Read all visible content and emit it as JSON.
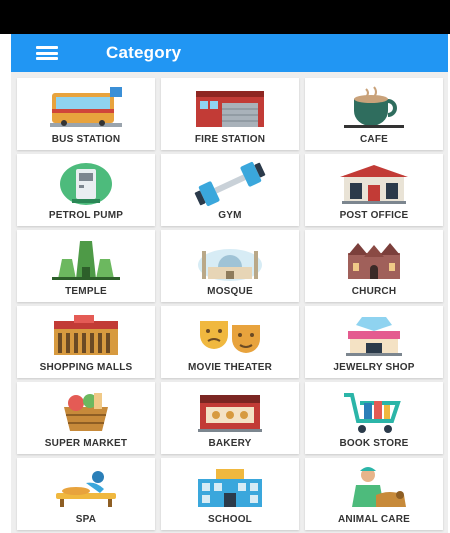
{
  "app": {
    "title": "Category"
  },
  "categories": [
    {
      "label": "BUS STATION",
      "icon": "bus-station-icon"
    },
    {
      "label": "FIRE STATION",
      "icon": "fire-station-icon"
    },
    {
      "label": "CAFE",
      "icon": "cafe-icon"
    },
    {
      "label": "PETROL PUMP",
      "icon": "petrol-pump-icon"
    },
    {
      "label": "GYM",
      "icon": "gym-icon"
    },
    {
      "label": "POST OFFICE",
      "icon": "post-office-icon"
    },
    {
      "label": "TEMPLE",
      "icon": "temple-icon"
    },
    {
      "label": "MOSQUE",
      "icon": "mosque-icon"
    },
    {
      "label": "CHURCH",
      "icon": "church-icon"
    },
    {
      "label": "SHOPPING MALLS",
      "icon": "shopping-mall-icon"
    },
    {
      "label": "MOVIE THEATER",
      "icon": "movie-theater-icon"
    },
    {
      "label": "JEWELRY SHOP",
      "icon": "jewelry-shop-icon"
    },
    {
      "label": "SUPER MARKET",
      "icon": "super-market-icon"
    },
    {
      "label": "BAKERY",
      "icon": "bakery-icon"
    },
    {
      "label": "BOOK STORE",
      "icon": "book-store-icon"
    },
    {
      "label": "SPA",
      "icon": "spa-icon"
    },
    {
      "label": "SCHOOL",
      "icon": "school-icon"
    },
    {
      "label": "ANIMAL CARE",
      "icon": "animal-care-icon"
    }
  ],
  "colors": {
    "appbar": "#2196F3",
    "statusbar": "#000000",
    "background": "#eeeeee"
  }
}
